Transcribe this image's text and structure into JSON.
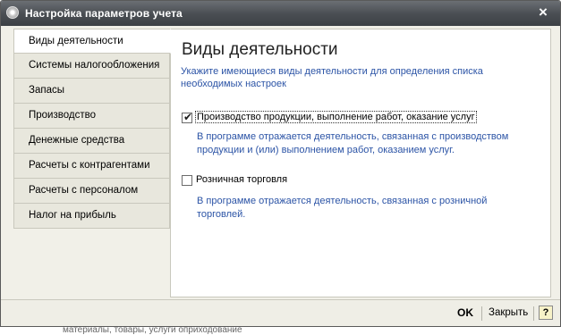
{
  "window": {
    "title": "Настройка параметров учета",
    "close_label": "×"
  },
  "tabs": [
    {
      "label": "Виды деятельности",
      "active": true
    },
    {
      "label": "Системы налогообложения",
      "active": false
    },
    {
      "label": "Запасы",
      "active": false
    },
    {
      "label": "Производство",
      "active": false
    },
    {
      "label": "Денежные средства",
      "active": false
    },
    {
      "label": "Расчеты с контрагентами",
      "active": false
    },
    {
      "label": "Расчеты с персоналом",
      "active": false
    },
    {
      "label": "Налог на прибыль",
      "active": false
    }
  ],
  "panel": {
    "title": "Виды деятельности",
    "description": "Укажите имеющиеся виды деятельности для определения списка необходимых настроек",
    "options": [
      {
        "label": "Производство продукции, выполнение работ, оказание услуг",
        "checked": true,
        "hint": "В программе отражается деятельность, связанная с производством продукции и (или) выполнением работ, оказанием услуг."
      },
      {
        "label": "Розничная торговля",
        "checked": false,
        "hint": "В программе отражается деятельность, связанная с розничной торговлей."
      }
    ]
  },
  "footer": {
    "ok_label": "OK",
    "close_label": "Закрыть",
    "help_label": "?"
  },
  "background": {
    "fragment_text": "материалы, товары, услуги оприходование"
  },
  "colors": {
    "accent_text": "#2c54a6",
    "titlebar": "#4b4f54"
  }
}
